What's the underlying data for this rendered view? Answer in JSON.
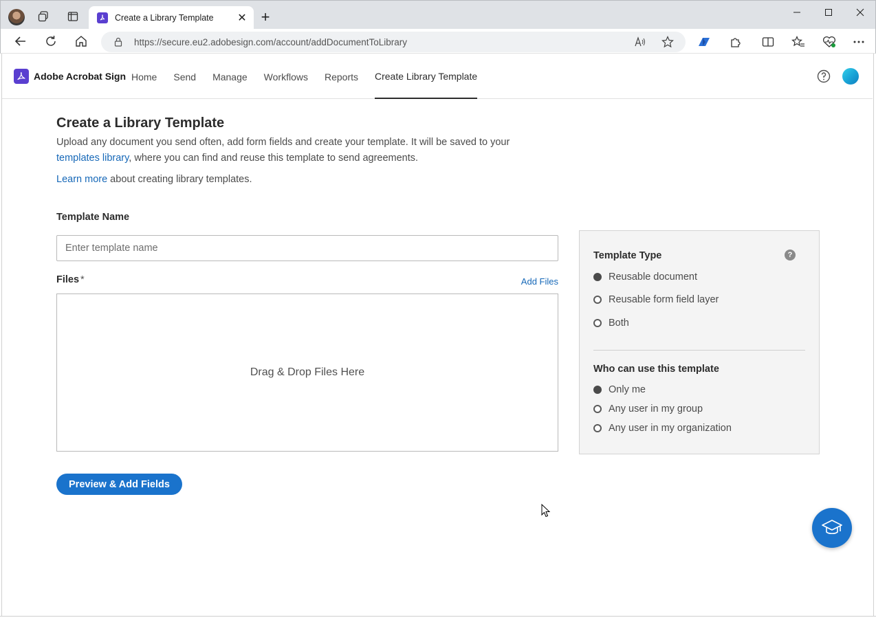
{
  "browser": {
    "tab_title": "Create a Library Template",
    "url": "https://secure.eu2.adobesign.com/account/addDocumentToLibrary"
  },
  "app": {
    "brand": "Adobe Acrobat Sign",
    "nav": [
      "Home",
      "Send",
      "Manage",
      "Workflows",
      "Reports",
      "Create Library Template"
    ],
    "active_nav": "Create Library Template"
  },
  "main": {
    "title": "Create a Library Template",
    "desc_part1": "Upload any document you send often, add form fields and create your template. It will be saved to your ",
    "desc_link": "templates library",
    "desc_part2": ", where you can find and reuse this template to send agreements.",
    "learn_link": "Learn more",
    "learn_rest": " about creating library templates.",
    "template_name_label": "Template Name",
    "template_name_placeholder": "Enter template name",
    "template_name_value": "",
    "files_label": "Files",
    "files_required_mark": "*",
    "add_files_label": "Add Files",
    "dropzone_text": "Drag & Drop Files Here",
    "primary_button": "Preview & Add Fields"
  },
  "panel": {
    "template_type_heading": "Template Type",
    "template_type_help": "?",
    "template_type_options": [
      "Reusable document",
      "Reusable form field layer",
      "Both"
    ],
    "template_type_selected": "Reusable document",
    "who_heading": "Who can use this template",
    "who_options": [
      "Only me",
      "Any user in my group",
      "Any user in my organization"
    ],
    "who_selected": "Only me"
  },
  "colors": {
    "brand": "#5a3fd0",
    "primary_button": "#1a73cc",
    "link": "#1668b8"
  }
}
